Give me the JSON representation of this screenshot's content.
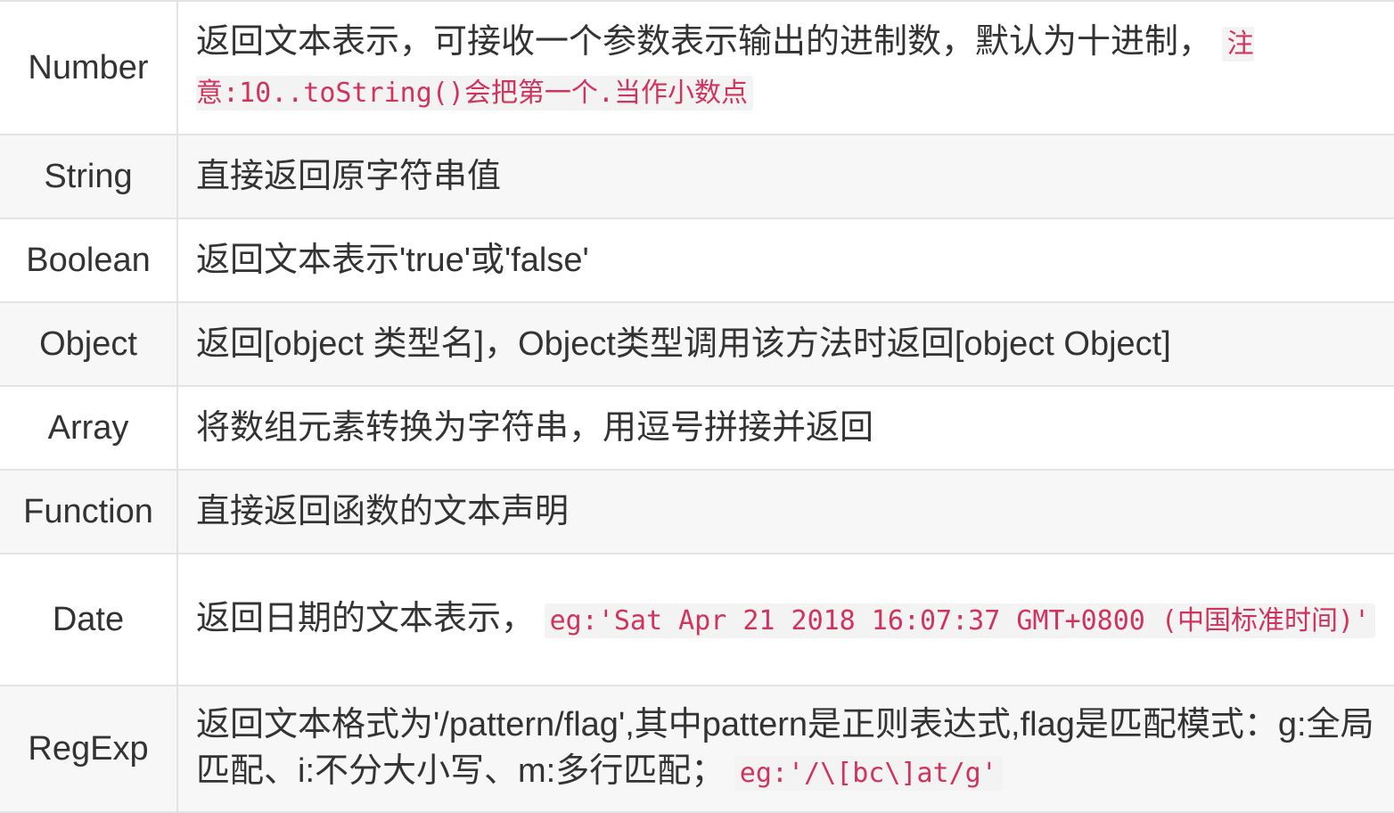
{
  "rows": [
    {
      "type": "Number",
      "desc": "返回文本表示，可接收一个参数表示输出的进制数，默认为十进制，",
      "code": "注意:10..toString()会把第一个.当作小数点"
    },
    {
      "type": "String",
      "desc": "直接返回原字符串值"
    },
    {
      "type": "Boolean",
      "desc": "返回文本表示'true'或'false'"
    },
    {
      "type": "Object",
      "desc": "返回[object 类型名]，Object类型调用该方法时返回[object Object]"
    },
    {
      "type": "Array",
      "desc": "将数组元素转换为字符串，用逗号拼接并返回"
    },
    {
      "type": "Function",
      "desc": "直接返回函数的文本声明"
    },
    {
      "type": "Date",
      "desc": "返回日期的文本表示，",
      "code": "eg:'Sat Apr 21 2018 16:07:37 GMT+0800 (中国标准时间)'"
    },
    {
      "type": "RegExp",
      "desc": "返回文本格式为'/pattern/flag',其中pattern是正则表达式,flag是匹配模式：g:全局匹配、i:不分大小写、m:多行匹配；",
      "code": "eg:'/\\[bc\\]at/g'"
    }
  ]
}
